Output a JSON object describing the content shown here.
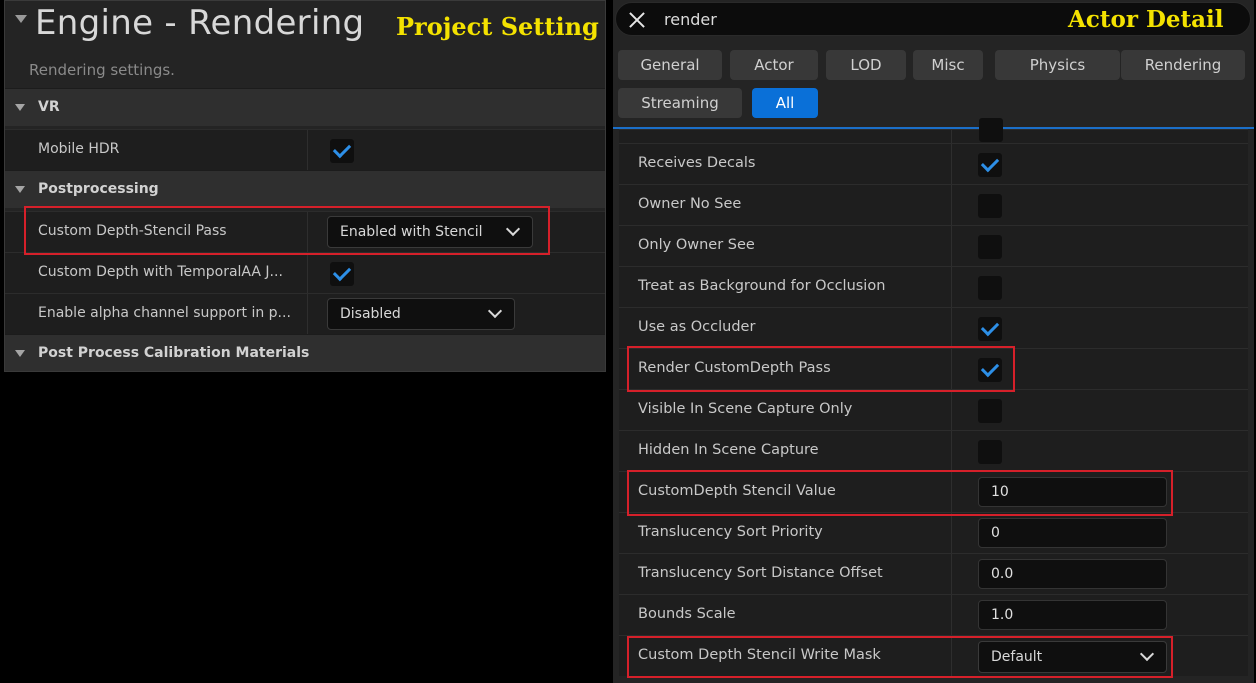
{
  "project_setting": {
    "title": "Engine - Rendering",
    "annotation": "Project Setting",
    "subtitle": "Rendering settings.",
    "sections": {
      "vr": "VR",
      "postprocessing": "Postprocessing",
      "calibration": "Post Process Calibration Materials"
    },
    "rows": {
      "mobile_hdr": {
        "label": "Mobile HDR",
        "checked": true
      },
      "custom_depth_stencil_pass": {
        "label": "Custom Depth-Stencil Pass",
        "value": "Enabled with Stencil"
      },
      "custom_depth_temporalaa": {
        "label": "Custom Depth with TemporalAA J...",
        "checked": true
      },
      "alpha_channel": {
        "label": "Enable alpha channel support in p...",
        "value": "Disabled"
      }
    }
  },
  "actor_detail": {
    "annotation": "Actor Detail",
    "search": {
      "value": "render"
    },
    "tabs": [
      "General",
      "Actor",
      "LOD",
      "Misc",
      "Physics",
      "Rendering",
      "Streaming",
      "All"
    ],
    "active_tab": "All",
    "rows": [
      {
        "label": "Receives Decals",
        "checked": true
      },
      {
        "label": "Owner No See",
        "checked": false
      },
      {
        "label": "Only Owner See",
        "checked": false
      },
      {
        "label": "Treat as Background for Occlusion",
        "checked": false
      },
      {
        "label": "Use as Occluder",
        "checked": true
      },
      {
        "label": "Render CustomDepth Pass",
        "checked": true
      },
      {
        "label": "Visible In Scene Capture Only",
        "checked": false
      },
      {
        "label": "Hidden In Scene Capture",
        "checked": false
      },
      {
        "label": "CustomDepth Stencil Value",
        "value": "10"
      },
      {
        "label": "Translucency Sort Priority",
        "value": "0"
      },
      {
        "label": "Translucency Sort Distance Offset",
        "value": "0.0"
      },
      {
        "label": "Bounds Scale",
        "value": "1.0"
      },
      {
        "label": "Custom Depth Stencil Write Mask",
        "value": "Default"
      }
    ]
  },
  "colors": {
    "highlight": "#d6202a",
    "accent": "#0a70d8",
    "annotation": "#f4e200"
  }
}
